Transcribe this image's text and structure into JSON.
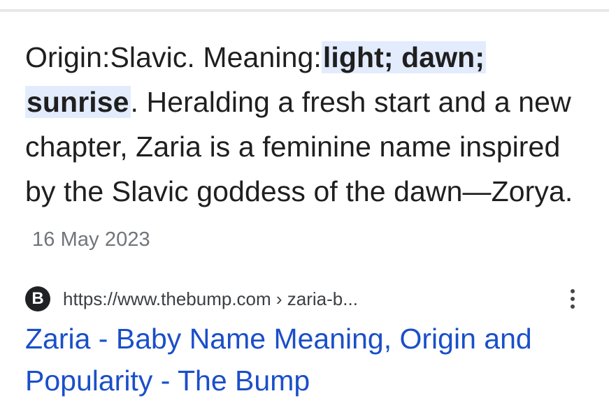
{
  "snippet": {
    "prefix": "Origin:Slavic. Meaning:",
    "highlight_1": "light; dawn;",
    "highlight_2": "sunrise",
    "body": ". Heralding a fresh start and a new chapter, Zaria is a feminine name inspired by the Slavic goddess of the dawn—Zorya.",
    "date": "16 May 2023"
  },
  "source": {
    "favicon_letter": "B",
    "url": "https://www.thebump.com › zaria-b..."
  },
  "result": {
    "title": "Zaria - Baby Name Meaning, Origin and Popularity - The Bump"
  },
  "icons": {
    "favicon": "thebump-logo-icon",
    "menu": "more-vert-icon"
  },
  "colors": {
    "link": "#1a4fc9",
    "highlight_bg": "#e3ecfd",
    "text": "#1f1f1f",
    "date": "#70757a"
  }
}
